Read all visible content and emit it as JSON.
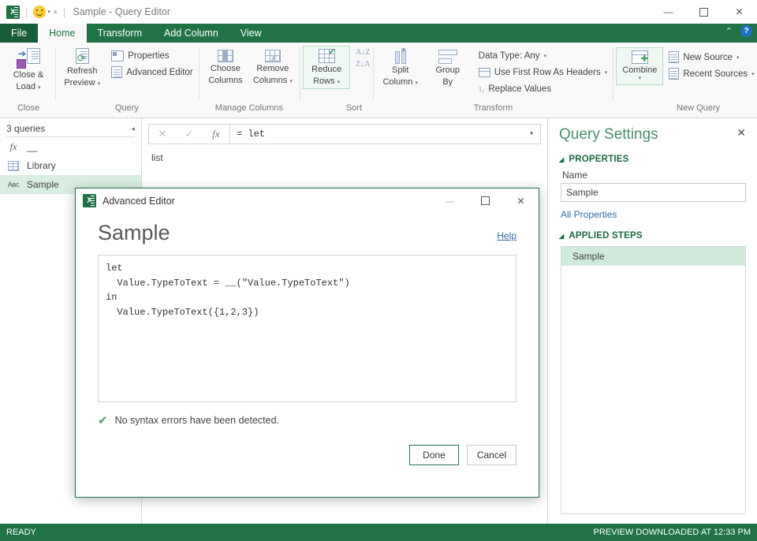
{
  "titlebar": {
    "app_icon": "excel-logo-icon",
    "smiley_icon": "smiley-feedback-icon",
    "qat_dropdown_icon": "quick-access-toolbar-dropdown-icon",
    "title": "Sample - Query Editor",
    "minimize": "—",
    "maximize": "☐",
    "close": "✕"
  },
  "ribbon": {
    "tabs": [
      {
        "label": "File",
        "active": false,
        "file": true
      },
      {
        "label": "Home",
        "active": true,
        "file": false
      },
      {
        "label": "Transform",
        "active": false,
        "file": false
      },
      {
        "label": "Add Column",
        "active": false,
        "file": false
      },
      {
        "label": "View",
        "active": false,
        "file": false
      }
    ],
    "collapse_icon": "chevron-up-icon",
    "help_icon": "help-question-icon",
    "help_label": "?",
    "groups": {
      "close": {
        "label": "Close",
        "close_and_load": {
          "line1": "Close &",
          "line2": "Load",
          "caret": "▾"
        }
      },
      "query": {
        "label": "Query",
        "refresh_preview": {
          "line1": "Refresh",
          "line2": "Preview",
          "caret": "▾"
        },
        "properties": "Properties",
        "advanced_editor": "Advanced Editor"
      },
      "manage_columns": {
        "label": "Manage Columns",
        "choose_columns": {
          "line1": "Choose",
          "line2": "Columns"
        },
        "remove_columns": {
          "line1": "Remove",
          "line2": "Columns",
          "caret": "▾"
        }
      },
      "reduce": {
        "reduce_rows": {
          "line1": "Reduce",
          "line2": "Rows",
          "caret": "▾"
        }
      },
      "sort": {
        "label": "Sort",
        "sort_asc": "A↓Z",
        "sort_desc": "Z↓A"
      },
      "transform": {
        "label": "Transform",
        "split_column": {
          "line1": "Split",
          "line2": "Column",
          "caret": "▾"
        },
        "group_by": {
          "line1": "Group",
          "line2": "By"
        },
        "data_type": "Data Type: Any",
        "data_type_caret": "▾",
        "use_first_row": "Use First Row As Headers",
        "use_first_row_caret": "▾",
        "replace_values": "Replace Values"
      },
      "new_query": {
        "label": "New Query",
        "combine": {
          "line1": "Combine",
          "caret": "▾"
        },
        "new_source": "New Source",
        "new_source_caret": "▾",
        "recent_sources": "Recent Sources",
        "recent_sources_caret": "▾"
      }
    }
  },
  "queries_pane": {
    "header": "3 queries",
    "collapse_icon": "collapse-pane-icon",
    "collapse_glyph": "◂",
    "items": [
      {
        "label": "__",
        "icon": "function-fx-icon",
        "icon_glyph": "fx",
        "selected": false
      },
      {
        "label": "Library",
        "icon": "table-icon",
        "icon_glyph": "",
        "selected": false
      },
      {
        "label": "Sample",
        "icon": "text-abc-icon",
        "icon_glyph": "Aʙс",
        "selected": true
      }
    ]
  },
  "formula_bar": {
    "cancel_icon": "cancel-x-icon",
    "cancel_glyph": "✕",
    "accept_icon": "accept-check-icon",
    "accept_glyph": "✓",
    "fx_icon": "insert-function-fx-icon",
    "fx_glyph": "fx",
    "value": "= let",
    "expand_icon": "expand-formula-chevron-icon",
    "expand_glyph": "▾"
  },
  "preview": {
    "label": "list"
  },
  "query_settings": {
    "title": "Query Settings",
    "close_icon": "close-pane-icon",
    "close_glyph": "✕",
    "properties_section": "PROPERTIES",
    "name_label": "Name",
    "name_value": "Sample",
    "all_properties": "All Properties",
    "applied_steps_section": "APPLIED STEPS",
    "section_expand_glyph": "◢",
    "steps": [
      {
        "label": "Sample",
        "selected": true
      }
    ]
  },
  "status_bar": {
    "left": "READY",
    "right": "PREVIEW DOWNLOADED AT 12:33 PM"
  },
  "dialog": {
    "icon": "excel-logo-icon",
    "title": "Advanced Editor",
    "minimize": "—",
    "maximize": "☐",
    "close": "✕",
    "heading": "Sample",
    "help_link": "Help",
    "code": "let\n  Value.TypeToText = __(\"Value.TypeToText\")\nin\n  Value.TypeToText({1,2,3})",
    "syntax_icon": "syntax-ok-check-icon",
    "syntax_glyph": "✔",
    "syntax_message": "No syntax errors have been detected.",
    "done_label": "Done",
    "cancel_label": "Cancel"
  },
  "colors": {
    "excel_green": "#217346",
    "dark_green": "#1a5c38",
    "selection_green": "#d9eee2",
    "step_green": "#cfeadb",
    "link_blue": "#2e6da4",
    "help_blue": "#1d72c4"
  }
}
